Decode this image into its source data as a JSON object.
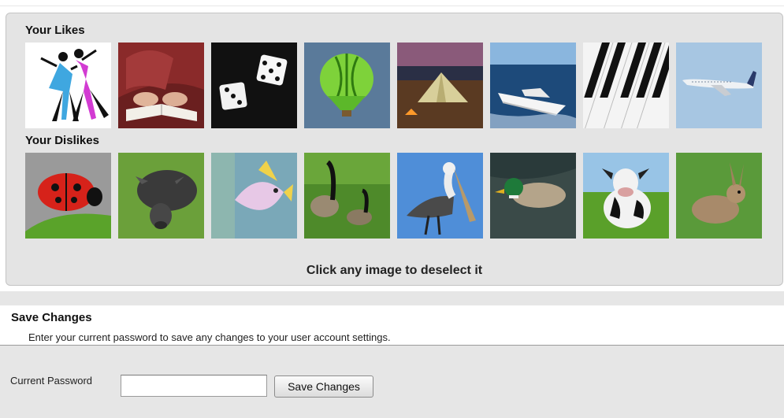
{
  "likes": {
    "heading": "Your Likes",
    "images": [
      {
        "subject": "dancers-icon"
      },
      {
        "subject": "reading-book-icon"
      },
      {
        "subject": "dice-icon"
      },
      {
        "subject": "hot-air-balloon-icon"
      },
      {
        "subject": "camping-tent-icon"
      },
      {
        "subject": "speedboat-icon"
      },
      {
        "subject": "piano-keys-icon"
      },
      {
        "subject": "airplane-icon"
      }
    ]
  },
  "dislikes": {
    "heading": "Your Dislikes",
    "images": [
      {
        "subject": "ladybug-icon"
      },
      {
        "subject": "pig-icon"
      },
      {
        "subject": "tropical-fish-icon"
      },
      {
        "subject": "geese-icon"
      },
      {
        "subject": "pelican-icon"
      },
      {
        "subject": "duck-icon"
      },
      {
        "subject": "cow-icon"
      },
      {
        "subject": "rabbit-icon"
      }
    ]
  },
  "deselect_hint": "Click any image to deselect it",
  "save_section": {
    "title": "Save Changes",
    "description": "Enter your current password to save any changes to your user account settings.",
    "password_label": "Current Password",
    "password_value": "",
    "button_label": "Save Changes"
  }
}
